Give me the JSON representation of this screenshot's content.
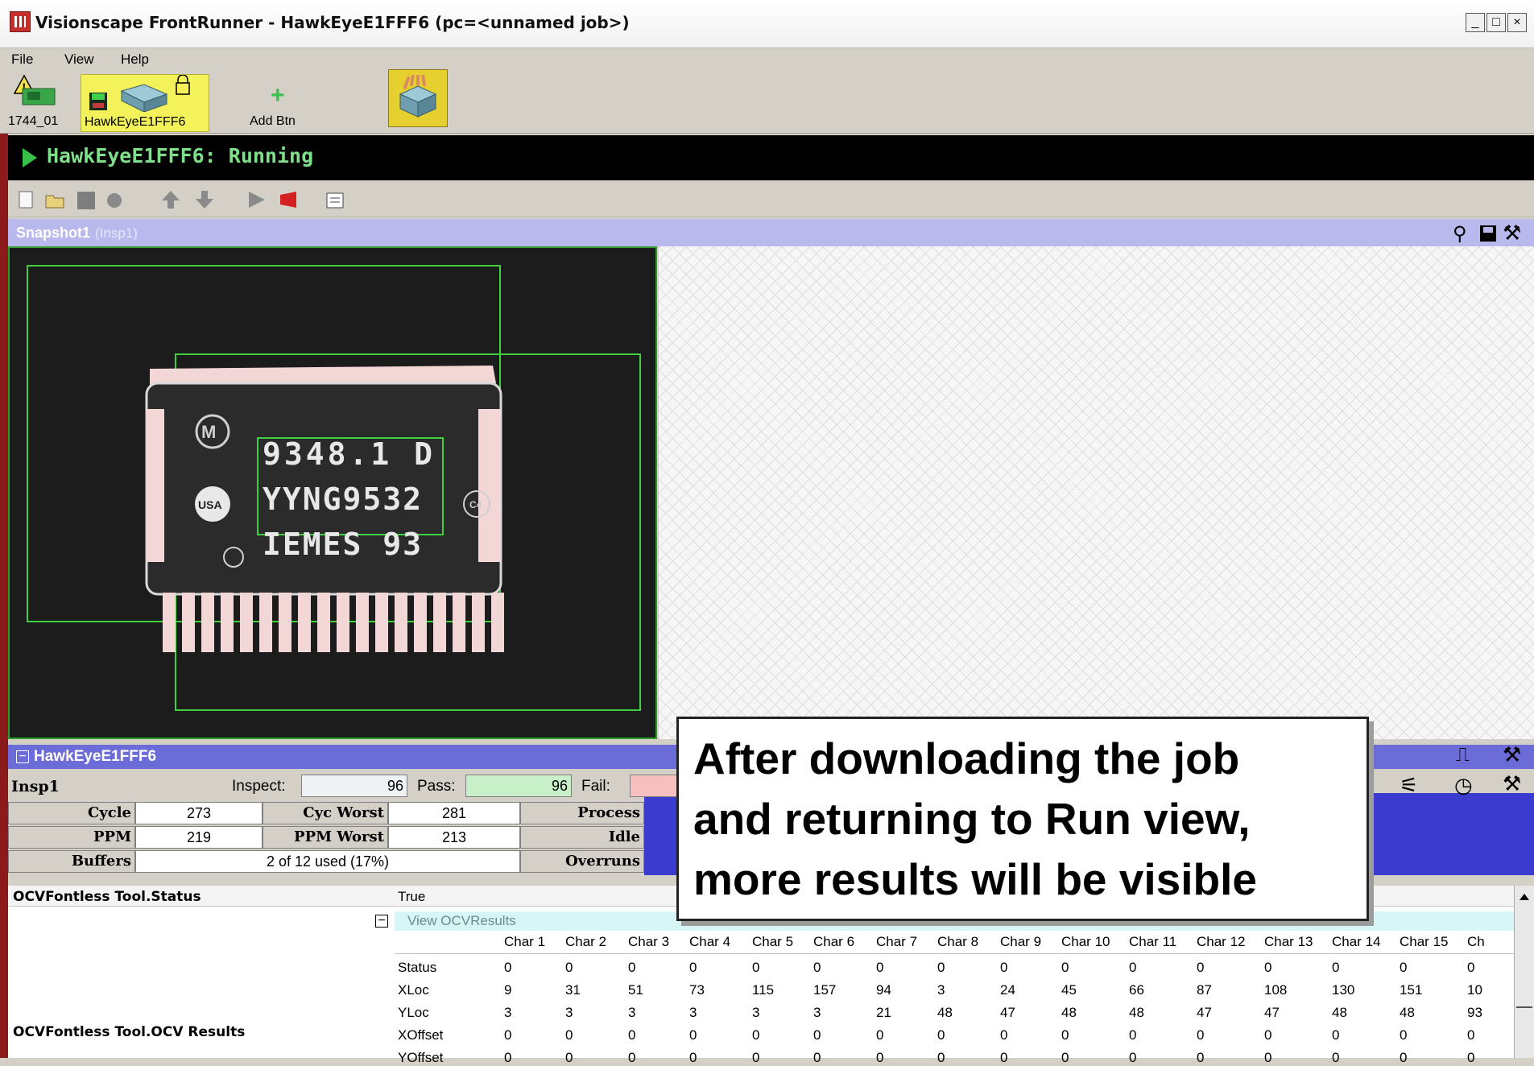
{
  "window": {
    "title": "Visionscape FrontRunner - HawkEyeE1FFF6 (pc=<unnamed job>)",
    "controls": [
      "_",
      "□",
      "×"
    ]
  },
  "menu": [
    "File",
    "View",
    "Help"
  ],
  "devices": [
    {
      "label": "1744_01",
      "icon": "camera-warning-icon"
    },
    {
      "label": "HawkEyeE1FFF6",
      "icon": "camera-locked-icon"
    },
    {
      "label": "Add Btn",
      "icon": "add-icon"
    }
  ],
  "run_status": "HawkEyeE1FFF6: Running",
  "snapshot": {
    "title": "Snapshot1",
    "sub": "(Insp1)"
  },
  "chip_text": [
    "9348.1 D",
    "YYNG9532",
    "IEMES 93"
  ],
  "device_panel": {
    "title": "HawkEyeE1FFF6"
  },
  "stats": {
    "insp": "Insp1",
    "inspect_label": "Inspect:",
    "inspect_value": "96",
    "pass_label": "Pass:",
    "pass_value": "96",
    "fail_label": "Fail:",
    "rows": [
      {
        "l1": "Cycle",
        "v1": "273",
        "l2": "Cyc Worst",
        "v2": "281",
        "l3": "Process"
      },
      {
        "l1": "PPM",
        "v1": "219",
        "l2": "PPM Worst",
        "v2": "213",
        "l3": "Idle"
      },
      {
        "l1": "Buffers",
        "v1": "2 of 12 used (17%)",
        "l3": "Overruns"
      }
    ]
  },
  "results": {
    "status_label": "OCVFontless Tool.Status",
    "status_value": "True",
    "ocv_label": "OCVFontless Tool.OCV Results",
    "view_label": "View OCVResults",
    "columns": [
      "Char 1",
      "Char 2",
      "Char 3",
      "Char 4",
      "Char 5",
      "Char 6",
      "Char 7",
      "Char 8",
      "Char 9",
      "Char 10",
      "Char 11",
      "Char 12",
      "Char 13",
      "Char 14",
      "Char 15",
      "Ch"
    ],
    "rows": [
      {
        "name": "Status",
        "values": [
          "0",
          "0",
          "0",
          "0",
          "0",
          "0",
          "0",
          "0",
          "0",
          "0",
          "0",
          "0",
          "0",
          "0",
          "0",
          "0"
        ]
      },
      {
        "name": "XLoc",
        "values": [
          "9",
          "31",
          "51",
          "73",
          "115",
          "157",
          "94",
          "3",
          "24",
          "45",
          "66",
          "87",
          "108",
          "130",
          "151",
          "10"
        ]
      },
      {
        "name": "YLoc",
        "values": [
          "3",
          "3",
          "3",
          "3",
          "3",
          "3",
          "21",
          "48",
          "47",
          "48",
          "48",
          "47",
          "47",
          "48",
          "48",
          "93"
        ]
      },
      {
        "name": "XOffset",
        "values": [
          "0",
          "0",
          "0",
          "0",
          "0",
          "0",
          "0",
          "0",
          "0",
          "0",
          "0",
          "0",
          "0",
          "0",
          "0",
          "0"
        ]
      },
      {
        "name": "YOffset",
        "values": [
          "0",
          "0",
          "0",
          "0",
          "0",
          "0",
          "0",
          "0",
          "0",
          "0",
          "0",
          "0",
          "0",
          "0",
          "0",
          "0"
        ]
      }
    ]
  },
  "callout": [
    "After downloading the job",
    "and returning to Run view,",
    "more results will be visible"
  ],
  "colors": {
    "running": "#37c14b",
    "header_blue": "#6c6cd9",
    "pass_green": "#c8f0c8",
    "fail_red": "#f6c0c0"
  }
}
